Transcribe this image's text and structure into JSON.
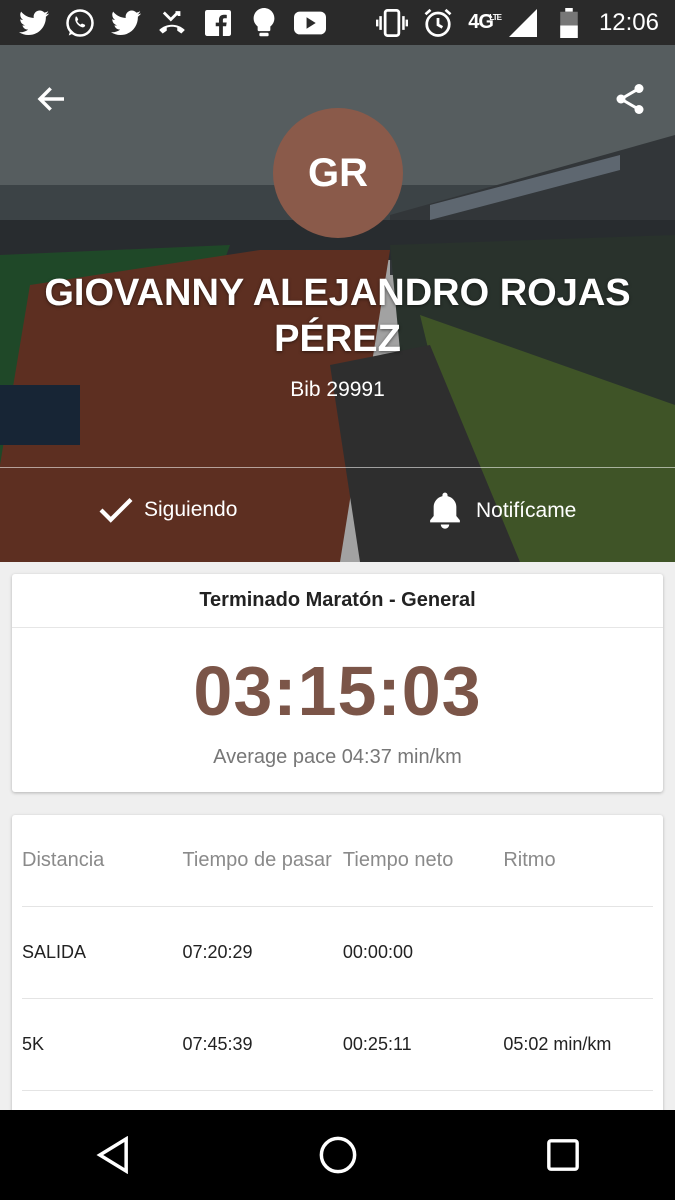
{
  "status_bar": {
    "time": "12:06",
    "network": "4G",
    "network_sub": "LTE",
    "left_icons": [
      "twitter-icon",
      "whatsapp-icon",
      "twitter-icon",
      "missed-call-icon",
      "facebook-icon",
      "bulb-icon",
      "youtube-icon"
    ],
    "right_icons": [
      "vibrate-icon",
      "alarm-icon",
      "signal-icon",
      "battery-icon"
    ]
  },
  "header": {
    "avatar_initials": "GR",
    "name": "GIOVANNY ALEJANDRO ROJAS PÉREZ",
    "bib": "Bib 29991",
    "follow_label": "Siguiendo",
    "notify_label": "Notifícame",
    "avatar_color": "#8a5a4a"
  },
  "result": {
    "title": "Terminado Maratón - General",
    "time": "03:15:03",
    "pace": "Average pace 04:37 min/km",
    "accent_color": "#7b5548"
  },
  "splits": {
    "columns": [
      "Distancia",
      "Tiempo de pasar",
      "Tiempo neto",
      "Ritmo"
    ],
    "rows": [
      {
        "distance": "SALIDA",
        "clock": "07:20:29",
        "net": "00:00:00",
        "pace": ""
      },
      {
        "distance": "5K",
        "clock": "07:45:39",
        "net": "00:25:11",
        "pace": "05:02 min/km"
      }
    ]
  }
}
